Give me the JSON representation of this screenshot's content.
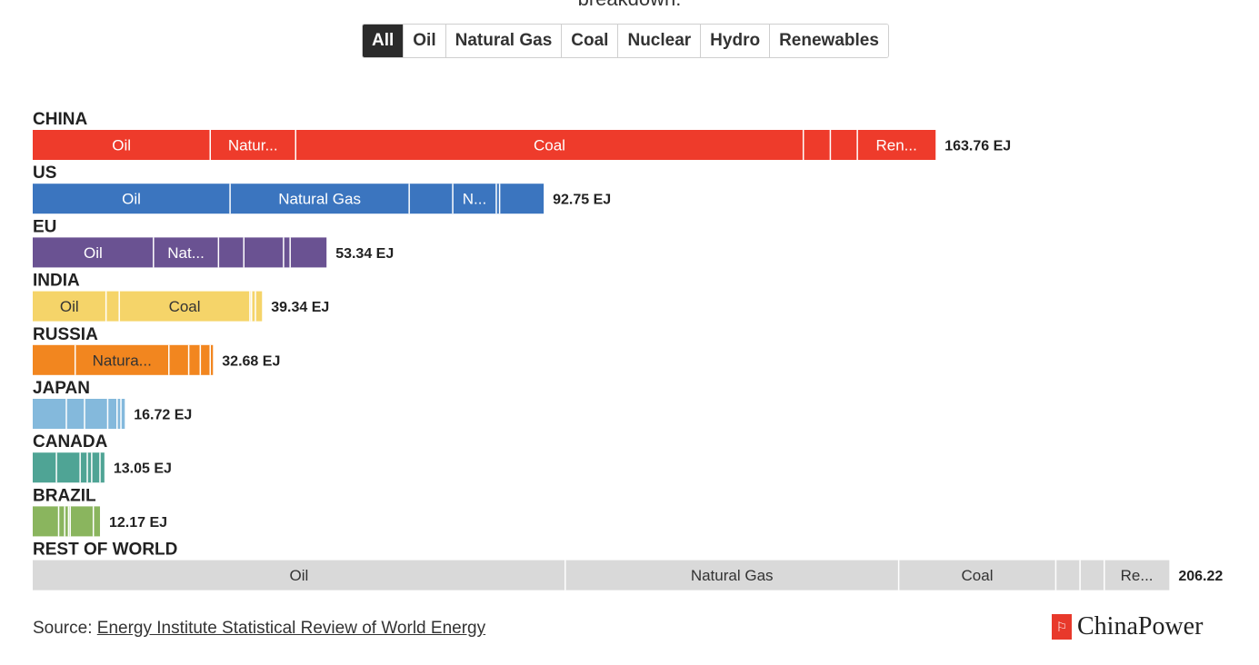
{
  "header_cut_text": "breakdown:",
  "tabs": [
    "All",
    "Oil",
    "Natural Gas",
    "Coal",
    "Nuclear",
    "Hydro",
    "Renewables"
  ],
  "active_tab": "All",
  "chart_data": {
    "type": "bar",
    "orientation": "horizontal",
    "stacked": true,
    "unit": "EJ",
    "sources": [
      "Oil",
      "Natural Gas",
      "Coal",
      "Nuclear",
      "Hydro",
      "Renewables"
    ],
    "countries": [
      {
        "name": "CHINA",
        "color": "#ee3b2b",
        "total_label": "163.76 EJ",
        "values": [
          32.2,
          15.5,
          92.1,
          4.9,
          4.9,
          14.2
        ],
        "labels": [
          "Oil",
          "Natur...",
          "Coal",
          "",
          "",
          "Ren..."
        ]
      },
      {
        "name": "US",
        "color": "#3b75bf",
        "total_label": "92.75 EJ",
        "values": [
          35.8,
          32.5,
          7.9,
          7.9,
          0.6,
          8.0
        ],
        "labels": [
          "Oil",
          "Natural Gas",
          "",
          "N...",
          "",
          ""
        ]
      },
      {
        "name": "EU",
        "color": "#6a5292",
        "total_label": "53.34 EJ",
        "values": [
          21.9,
          11.8,
          4.6,
          7.2,
          1.2,
          6.6
        ],
        "labels": [
          "Oil",
          "Nat...",
          "",
          "",
          "",
          ""
        ]
      },
      {
        "name": "INDIA",
        "color": "#f5d469",
        "total_label": "39.34 EJ",
        "values": [
          13.3,
          2.4,
          23.7,
          0.3,
          0.7,
          1.2
        ],
        "labels": [
          "Oil",
          "",
          "Coal",
          "",
          "",
          ""
        ],
        "dark_text": true
      },
      {
        "name": "RUSSIA",
        "color": "#f2861f",
        "total_label": "32.68 EJ",
        "values": [
          7.7,
          17.0,
          3.6,
          2.1,
          1.8,
          0.5
        ],
        "labels": [
          "",
          "Natura...",
          "",
          "",
          "",
          ""
        ],
        "dark_text": true
      },
      {
        "name": "JAPAN",
        "color": "#84b9dc",
        "total_label": "16.72 EJ",
        "values": [
          6.1,
          3.3,
          4.2,
          1.7,
          0.7,
          0.7
        ],
        "labels": [
          "",
          "",
          "",
          "",
          "",
          ""
        ]
      },
      {
        "name": "CANADA",
        "color": "#4fa495",
        "total_label": "13.05 EJ",
        "values": [
          4.3,
          4.3,
          1.3,
          0.8,
          1.5,
          0.8
        ],
        "labels": [
          "",
          "",
          "",
          "",
          "",
          ""
        ]
      },
      {
        "name": "BRAZIL",
        "color": "#8ab55e",
        "total_label": "12.17 EJ",
        "values": [
          4.7,
          1.1,
          0.7,
          0.3,
          4.2,
          1.2
        ],
        "labels": [
          "",
          "",
          "",
          "",
          "",
          ""
        ]
      },
      {
        "name": "REST OF WORLD",
        "color": "#d9d9d9",
        "total_label": "206.22",
        "values": [
          96.6,
          60.5,
          28.5,
          4.4,
          4.4,
          11.8
        ],
        "labels": [
          "Oil",
          "Natural Gas",
          "Coal",
          "",
          "",
          "Re..."
        ],
        "dark_text": true
      }
    ]
  },
  "source": {
    "prefix": "Source: ",
    "link_text": "Energy Institute Statistical Review of World Energy"
  },
  "brand": {
    "mark": "⚐",
    "name": "ChinaPower"
  }
}
